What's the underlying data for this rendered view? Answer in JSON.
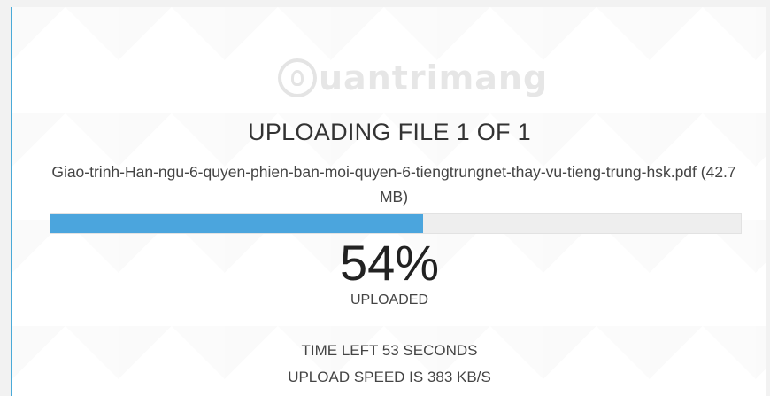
{
  "watermark": {
    "text": "uantrimang",
    "icon": "lightbulb-icon"
  },
  "upload": {
    "title": "UPLOADING FILE 1 OF 1",
    "filename": "Giao-trinh-Han-ngu-6-quyen-phien-ban-moi-quyen-6-tiengtrungnet-thay-vu-tieng-trung-hsk.pdf (42.7 MB)",
    "progress_fraction": 0.54,
    "percent_label": "54%",
    "uploaded_label": "UPLOADED",
    "time_left": "TIME LEFT 53 SECONDS",
    "speed": "UPLOAD SPEED IS 383 KB/S"
  },
  "colors": {
    "progress_fill": "#4ba5dd",
    "progress_track": "#eeeeee",
    "panel_accent": "#4aaad8"
  }
}
